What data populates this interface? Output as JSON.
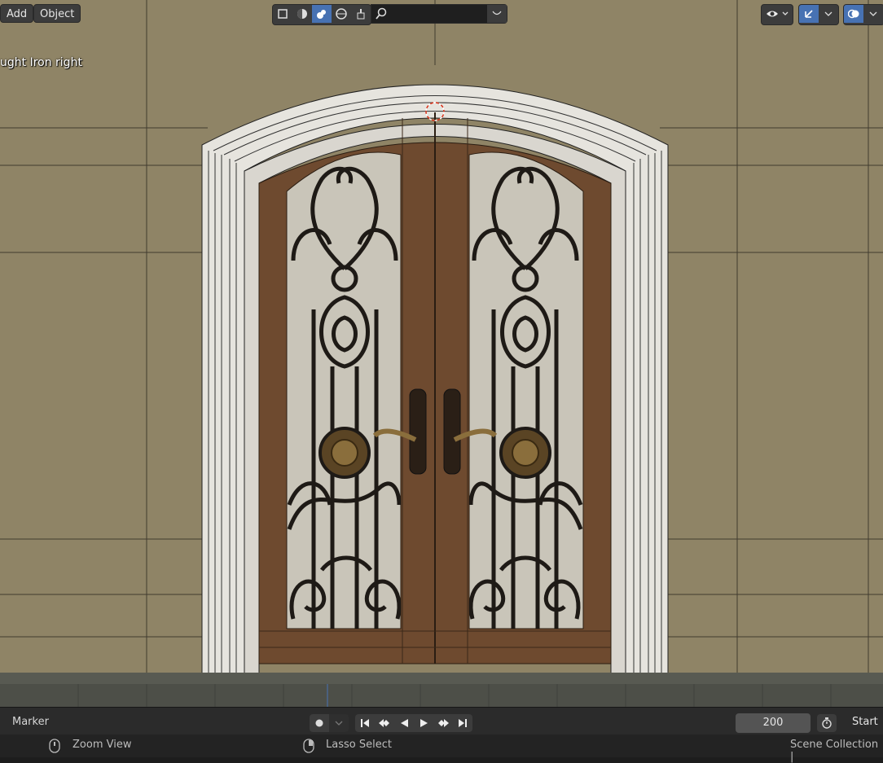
{
  "header": {
    "add_label": "Add",
    "object_label": "Object",
    "search_placeholder": ""
  },
  "viewport": {
    "object_name_partial": "ught Iron right"
  },
  "timeline": {
    "marker_label": "Marker",
    "current_frame": "200",
    "start_label": "Start"
  },
  "status_bar": {
    "zoom_view": "Zoom View",
    "lasso_select": "Lasso Select",
    "scene_collection": "Scene Collection |"
  },
  "colors": {
    "wall": "#8f8466",
    "wood": "#6e4a2f",
    "iron": "#1e1a16",
    "glass": "#c8c4b8",
    "frame": "#e4e2dc",
    "accent": "#4772b3"
  },
  "icons": [
    "wireframe-shading-icon",
    "solid-shading-icon",
    "material-shading-icon",
    "rendered-shading-icon",
    "paint-icon",
    "search-icon",
    "visibility-icon",
    "gizmo-icon",
    "overlay-icon"
  ]
}
